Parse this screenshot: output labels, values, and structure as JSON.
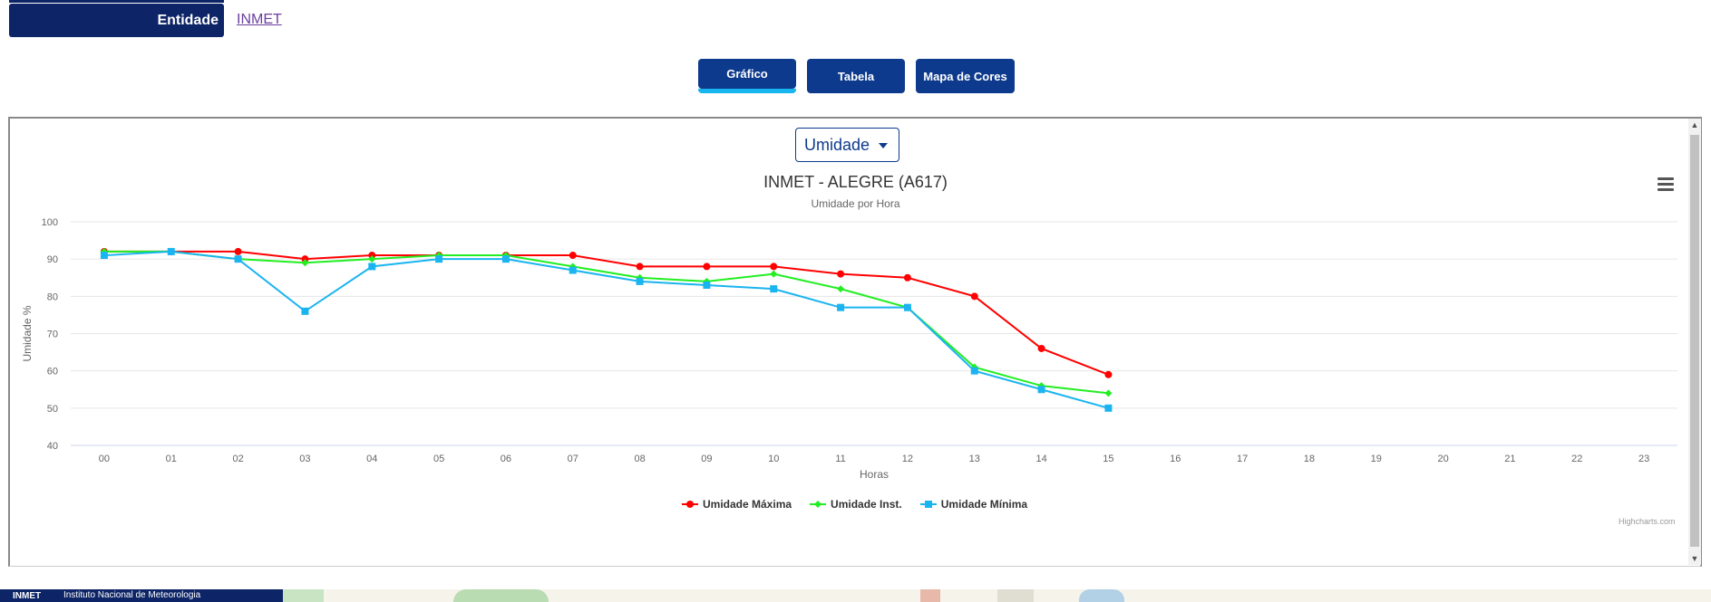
{
  "entity": {
    "label": "Entidade",
    "value": "INMET"
  },
  "tabs": [
    {
      "label": "Gráfico",
      "active": true
    },
    {
      "label": "Tabela",
      "active": false
    },
    {
      "label": "Mapa de Cores",
      "active": false
    }
  ],
  "variable_select": {
    "value": "Umidade"
  },
  "chart_data": {
    "type": "line",
    "title": "INMET - ALEGRE (A617)",
    "subtitle": "Umidade por Hora",
    "xlabel": "Horas",
    "ylabel": "Umidade %",
    "categories": [
      "00",
      "01",
      "02",
      "03",
      "04",
      "05",
      "06",
      "07",
      "08",
      "09",
      "10",
      "11",
      "12",
      "13",
      "14",
      "15",
      "16",
      "17",
      "18",
      "19",
      "20",
      "21",
      "22",
      "23"
    ],
    "ylim": [
      40,
      100
    ],
    "yticks": [
      40,
      50,
      60,
      70,
      80,
      90,
      100
    ],
    "grid": true,
    "legend_position": "bottom",
    "series": [
      {
        "name": "Umidade Máxima",
        "color": "#ff0000",
        "marker": "circle",
        "values": [
          92,
          92,
          92,
          90,
          91,
          91,
          91,
          91,
          88,
          88,
          88,
          86,
          85,
          80,
          66,
          59
        ]
      },
      {
        "name": "Umidade Inst.",
        "color": "#22ee22",
        "marker": "diamond",
        "values": [
          92,
          92,
          90,
          89,
          90,
          91,
          91,
          88,
          85,
          84,
          86,
          82,
          77,
          61,
          56,
          54
        ]
      },
      {
        "name": "Umidade Mínima",
        "color": "#1ab4f0",
        "marker": "square",
        "values": [
          91,
          92,
          90,
          76,
          88,
          90,
          90,
          87,
          84,
          83,
          82,
          77,
          77,
          60,
          55,
          50
        ]
      }
    ]
  },
  "credits": "Highcharts.com",
  "footer": {
    "brand": "INMET",
    "name": "Instituto Nacional de Meteorologia"
  },
  "icons": {
    "menu": "hamburger-menu-icon",
    "select_caret": "caret-down-icon"
  }
}
